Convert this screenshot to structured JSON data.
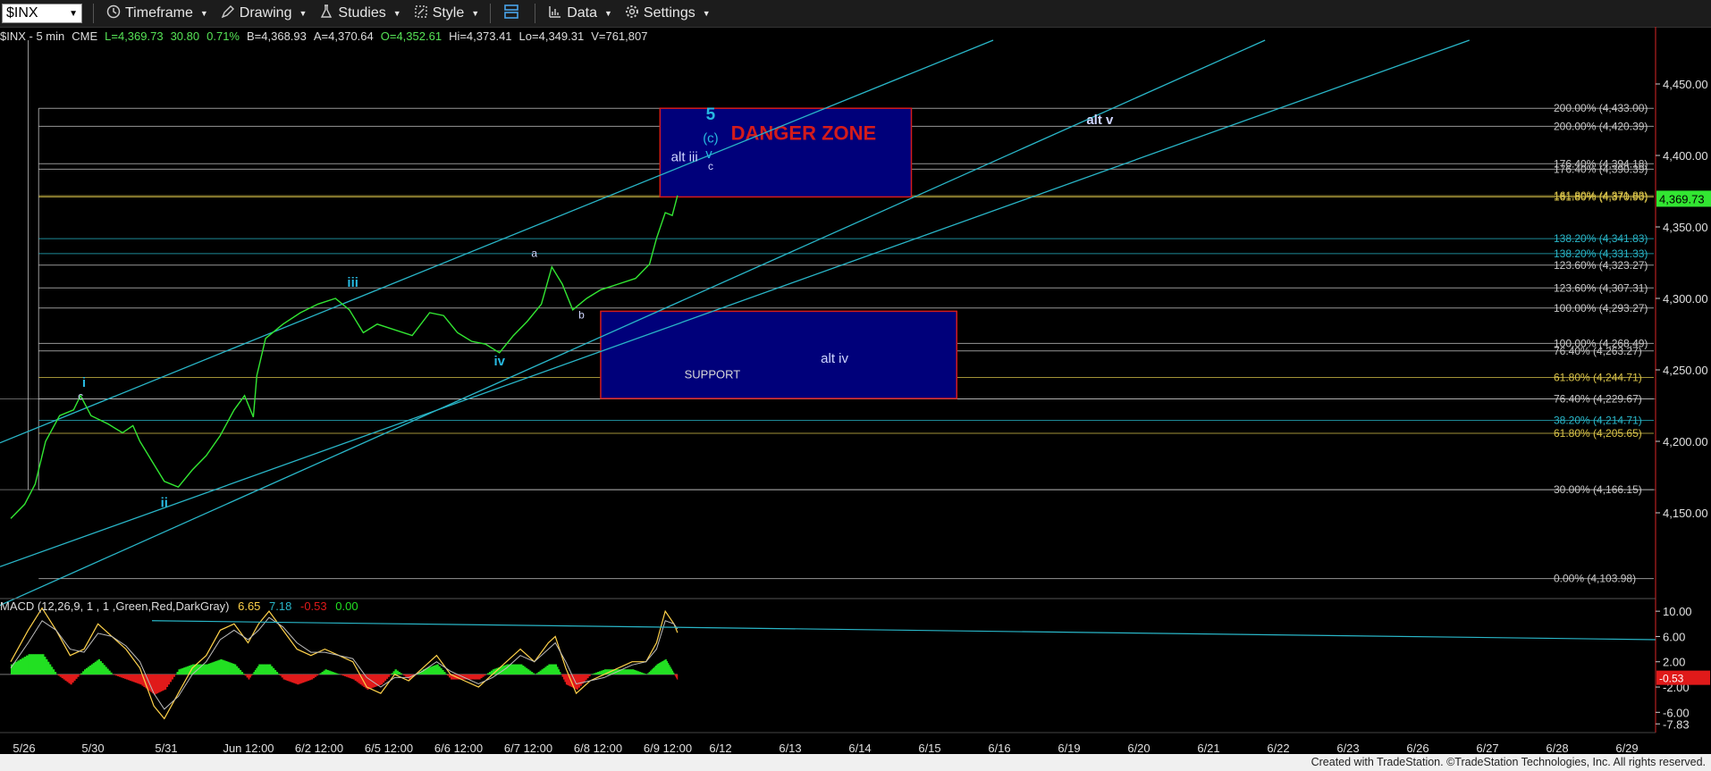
{
  "toolbar": {
    "symbol": "$INX",
    "items": [
      {
        "label": "Timeframe",
        "icon": "clock-icon"
      },
      {
        "label": "Drawing",
        "icon": "pencil-icon"
      },
      {
        "label": "Studies",
        "icon": "flask-icon"
      },
      {
        "label": "Style",
        "icon": "style-icon"
      },
      {
        "label": "",
        "icon": "layout-icon"
      },
      {
        "label": "Data",
        "icon": "bar-chart-icon"
      },
      {
        "label": "Settings",
        "icon": "gear-icon"
      }
    ]
  },
  "status": {
    "symbol": "$INX - 5 min",
    "exchange": "CME",
    "last": "L=4,369.73",
    "change": "30.80",
    "pct": "0.71%",
    "bid": "B=4,368.93",
    "ask": "A=4,370.64",
    "open": "O=4,352.61",
    "high": "Hi=4,373.41",
    "low": "Lo=4,349.31",
    "volume": "V=761,807"
  },
  "macd_legend": {
    "label": "MACD (12,26,9, 1 , 1 ,Green,Red,DarkGray)",
    "v1": "6.65",
    "v2": "7.18",
    "v3": "-0.53",
    "v4": "0.00"
  },
  "footer": "Created with TradeStation. ©TradeStation Technologies, Inc. All rights reserved.",
  "colors": {
    "price": "#32e632",
    "channel": "#29b6c8",
    "danger_box": "#00007a",
    "support_box": "#00007a",
    "danger_text": "#d41b1b",
    "wave": "#27b8e0",
    "macd_hist_pos": "#22e022",
    "macd_hist_neg": "#e01a1a"
  },
  "chart_data": {
    "type": "line",
    "ylim": [
      4090,
      4490
    ],
    "y_ticks": [
      4150,
      4200,
      4250,
      4300,
      4350,
      4400,
      4450
    ],
    "y_tick_labels": [
      "4,150.00",
      "4,200.00",
      "4,250.00",
      "4,300.00",
      "4,350.00",
      "4,400.00",
      "4,450.00"
    ],
    "x_tick_labels": [
      "5/26",
      "5/30",
      "5/31",
      "Jun 12:00",
      "6/2 12:00",
      "6/5 12:00",
      "6/6 12:00",
      "6/7 12:00",
      "6/8 12:00",
      "6/9 12:00",
      "6/12",
      "6/13",
      "6/14",
      "6/15",
      "6/16",
      "6/19",
      "6/20",
      "6/21",
      "6/22",
      "6/23",
      "6/26",
      "6/27",
      "6/28",
      "6/29"
    ],
    "last_price_label": "4,369.73",
    "price_series": [
      [
        0,
        4146
      ],
      [
        0.4,
        4156
      ],
      [
        0.7,
        4170
      ],
      [
        1,
        4200
      ],
      [
        1.4,
        4218
      ],
      [
        1.8,
        4222
      ],
      [
        2,
        4232
      ],
      [
        2.3,
        4218
      ],
      [
        2.8,
        4212
      ],
      [
        3.2,
        4206
      ],
      [
        3.5,
        4211
      ],
      [
        3.7,
        4200
      ],
      [
        4,
        4188
      ],
      [
        4.4,
        4172
      ],
      [
        4.8,
        4168
      ],
      [
        5.2,
        4180
      ],
      [
        5.6,
        4190
      ],
      [
        6,
        4204
      ],
      [
        6.4,
        4222
      ],
      [
        6.7,
        4232
      ],
      [
        6.95,
        4217
      ],
      [
        7.05,
        4246
      ],
      [
        7.3,
        4272
      ],
      [
        7.8,
        4282
      ],
      [
        8.3,
        4290
      ],
      [
        8.8,
        4296
      ],
      [
        9.3,
        4300
      ],
      [
        9.7,
        4292
      ],
      [
        10.1,
        4276
      ],
      [
        10.5,
        4282
      ],
      [
        11,
        4278
      ],
      [
        11.5,
        4274
      ],
      [
        12,
        4290
      ],
      [
        12.4,
        4288
      ],
      [
        12.8,
        4276
      ],
      [
        13.2,
        4270
      ],
      [
        13.6,
        4268
      ],
      [
        14,
        4262
      ],
      [
        14.4,
        4274
      ],
      [
        14.8,
        4284
      ],
      [
        15.2,
        4296
      ],
      [
        15.5,
        4322
      ],
      [
        15.8,
        4310
      ],
      [
        16.1,
        4292
      ],
      [
        16.5,
        4300
      ],
      [
        16.9,
        4306
      ],
      [
        17.4,
        4310
      ],
      [
        17.9,
        4314
      ],
      [
        18.3,
        4324
      ],
      [
        18.5,
        4342
      ],
      [
        18.75,
        4360
      ],
      [
        18.95,
        4358
      ],
      [
        19.1,
        4372
      ]
    ],
    "danger_zone": {
      "label": "DANGER ZONE",
      "x0": 18.6,
      "x1": 25.8,
      "y0": 4371,
      "y1": 4433
    },
    "support_zone": {
      "label": "SUPPORT",
      "x0": 16.9,
      "x1": 27.1,
      "y0": 4230,
      "y1": 4291
    },
    "fib_levels": [
      {
        "label": "200.00% (4,433.00)",
        "y": 4433.0,
        "color": "#c8c8c8"
      },
      {
        "label": "200.00% (4,420.39)",
        "y": 4420.39,
        "color": "#c8c8c8"
      },
      {
        "label": "176.40% (4,394.18)",
        "y": 4394.18,
        "color": "#c8c8c8"
      },
      {
        "label": "176.40% (4,390.39)",
        "y": 4390.39,
        "color": "#c8c8c8"
      },
      {
        "label": "161.80% (4,371.83)",
        "y": 4371.83,
        "color": "#d9c34a"
      },
      {
        "label": "161.80% (4,370.90)",
        "y": 4370.9,
        "color": "#d9c34a"
      },
      {
        "label": "138.20% (4,341.83)",
        "y": 4341.83,
        "color": "#29b6c8"
      },
      {
        "label": "138.20% (4,331.33)",
        "y": 4331.33,
        "color": "#29b6c8"
      },
      {
        "label": "123.60% (4,323.27)",
        "y": 4323.27,
        "color": "#c8c8c8"
      },
      {
        "label": "123.60% (4,307.31)",
        "y": 4307.31,
        "color": "#c8c8c8"
      },
      {
        "label": "100.00% (4,293.27)",
        "y": 4293.27,
        "color": "#c8c8c8"
      },
      {
        "label": "100.00% (4,268.49)",
        "y": 4268.49,
        "color": "#c8c8c8"
      },
      {
        "label": "76.40% (4,263.27)",
        "y": 4263.27,
        "color": "#c8c8c8"
      },
      {
        "label": "61.80% (4,244.71)",
        "y": 4244.71,
        "color": "#d9c34a"
      },
      {
        "label": "76.40% (4,229.67)",
        "y": 4229.67,
        "color": "#c8c8c8"
      },
      {
        "label": "38.20% (4,214.71)",
        "y": 4214.71,
        "color": "#29b6c8"
      },
      {
        "label": "61.80% (4,205.65)",
        "y": 4205.65,
        "color": "#d9c34a"
      },
      {
        "label": "30.00% (4,166.15)",
        "y": 4166.15,
        "color": "#c8c8c8"
      },
      {
        "label": "0.00% (4,103.98)",
        "y": 4103.98,
        "color": "#c8c8c8"
      }
    ],
    "wave_labels": [
      {
        "text": "i",
        "x": 2.1,
        "y": 4238
      },
      {
        "text": "c",
        "x": 2.0,
        "y": 4229
      },
      {
        "text": "ii",
        "x": 4.4,
        "y": 4154
      },
      {
        "text": "iii",
        "x": 9.8,
        "y": 4308
      },
      {
        "text": "iv",
        "x": 14,
        "y": 4253
      },
      {
        "text": "a",
        "x": 15,
        "y": 4329
      },
      {
        "text": "b",
        "x": 16.35,
        "y": 4286
      },
      {
        "text": "5",
        "x": 20.05,
        "y": 4425
      },
      {
        "text": "(c)",
        "x": 20.05,
        "y": 4409
      },
      {
        "text": "alt iii",
        "x": 19.3,
        "y": 4396
      },
      {
        "text": "v",
        "x": 20,
        "y": 4398
      },
      {
        "text": "c",
        "x": 20.05,
        "y": 4390
      },
      {
        "text": "alt v",
        "x": 31.2,
        "y": 4422
      },
      {
        "text": "alt iv",
        "x": 23.6,
        "y": 4255
      }
    ],
    "macd": {
      "ylim": [
        -8.5,
        12
      ],
      "y_tick_labels": [
        "10.00",
        "6.00",
        "2.00",
        "-2.00",
        "-6.00",
        "-7.83"
      ],
      "y_ticks": [
        10,
        6,
        2,
        -2,
        -6,
        -7.83
      ],
      "current_label": "-0.53",
      "macd_line": [
        [
          0,
          2
        ],
        [
          0.5,
          7
        ],
        [
          0.9,
          10.5
        ],
        [
          1.3,
          7
        ],
        [
          1.7,
          3
        ],
        [
          2.1,
          4
        ],
        [
          2.5,
          8
        ],
        [
          2.9,
          6
        ],
        [
          3.3,
          4
        ],
        [
          3.7,
          1
        ],
        [
          4.1,
          -5
        ],
        [
          4.4,
          -7
        ],
        [
          4.8,
          -3
        ],
        [
          5.2,
          1
        ],
        [
          5.6,
          3
        ],
        [
          6,
          7
        ],
        [
          6.4,
          8
        ],
        [
          6.8,
          5
        ],
        [
          7.1,
          8
        ],
        [
          7.4,
          10
        ],
        [
          7.8,
          7
        ],
        [
          8.2,
          4
        ],
        [
          8.6,
          3
        ],
        [
          9,
          4
        ],
        [
          9.4,
          3
        ],
        [
          9.8,
          2
        ],
        [
          10.2,
          -2
        ],
        [
          10.6,
          -3
        ],
        [
          11,
          0
        ],
        [
          11.4,
          -1
        ],
        [
          11.8,
          1
        ],
        [
          12.2,
          3
        ],
        [
          12.6,
          0
        ],
        [
          13,
          -1
        ],
        [
          13.4,
          -2
        ],
        [
          13.8,
          0
        ],
        [
          14.2,
          2
        ],
        [
          14.6,
          4
        ],
        [
          15,
          2
        ],
        [
          15.4,
          5
        ],
        [
          15.6,
          6
        ],
        [
          15.9,
          1
        ],
        [
          16.2,
          -3
        ],
        [
          16.6,
          -1
        ],
        [
          17,
          0
        ],
        [
          17.4,
          1
        ],
        [
          17.8,
          2
        ],
        [
          18.2,
          2
        ],
        [
          18.5,
          5
        ],
        [
          18.75,
          10
        ],
        [
          19,
          8
        ],
        [
          19.1,
          6.6
        ]
      ],
      "signal_line": [
        [
          0,
          1
        ],
        [
          0.5,
          5
        ],
        [
          0.9,
          8.5
        ],
        [
          1.3,
          7
        ],
        [
          1.7,
          4
        ],
        [
          2.1,
          3.5
        ],
        [
          2.5,
          6.5
        ],
        [
          2.9,
          6
        ],
        [
          3.3,
          4.5
        ],
        [
          3.7,
          2
        ],
        [
          4.1,
          -3
        ],
        [
          4.4,
          -5.5
        ],
        [
          4.8,
          -3.5
        ],
        [
          5.2,
          0
        ],
        [
          5.6,
          2
        ],
        [
          6,
          5.5
        ],
        [
          6.4,
          7
        ],
        [
          6.8,
          5.5
        ],
        [
          7.1,
          7
        ],
        [
          7.4,
          9
        ],
        [
          7.8,
          7.5
        ],
        [
          8.2,
          5
        ],
        [
          8.6,
          3.5
        ],
        [
          9,
          3.5
        ],
        [
          9.4,
          3
        ],
        [
          9.8,
          2.5
        ],
        [
          10.2,
          -0.5
        ],
        [
          10.6,
          -2
        ],
        [
          11,
          -0.5
        ],
        [
          11.4,
          -0.5
        ],
        [
          11.8,
          0.5
        ],
        [
          12.2,
          2
        ],
        [
          12.6,
          0.5
        ],
        [
          13,
          -0.5
        ],
        [
          13.4,
          -1.5
        ],
        [
          13.8,
          -0.5
        ],
        [
          14.2,
          1
        ],
        [
          14.6,
          3
        ],
        [
          15,
          2
        ],
        [
          15.4,
          4
        ],
        [
          15.6,
          5
        ],
        [
          15.9,
          2
        ],
        [
          16.2,
          -1.5
        ],
        [
          16.6,
          -1
        ],
        [
          17,
          -0.5
        ],
        [
          17.4,
          0.5
        ],
        [
          17.8,
          1.5
        ],
        [
          18.2,
          2
        ],
        [
          18.5,
          4
        ],
        [
          18.75,
          8.5
        ],
        [
          19,
          8
        ],
        [
          19.1,
          7.2
        ]
      ]
    }
  }
}
